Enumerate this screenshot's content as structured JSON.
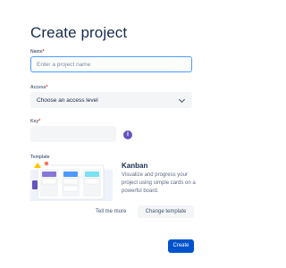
{
  "page": {
    "title": "Create project"
  },
  "form": {
    "name": {
      "label": "Name",
      "required_mark": "*",
      "placeholder": "Enter a project name",
      "value": ""
    },
    "access": {
      "label": "Access",
      "required_mark": "*",
      "selected": "Choose an access level"
    },
    "key": {
      "label": "Key",
      "required_mark": "*",
      "value": ""
    }
  },
  "template": {
    "section_label": "Template",
    "name": "Kanban",
    "description": "Visualize and progress your project using simple cards on a powerful board.",
    "tell_me_more": "Tell me more",
    "change_template": "Change template"
  },
  "actions": {
    "create": "Create"
  },
  "icons": {
    "info": "info-icon",
    "chevron": "chevron-down-icon",
    "template_illustration": "kanban-board-illustration"
  },
  "colors": {
    "primary": "#0052cc",
    "focus_border": "#4c9aff",
    "info_purple": "#6554c0",
    "required_red": "#de350b",
    "field_bg": "#f4f5f7"
  }
}
